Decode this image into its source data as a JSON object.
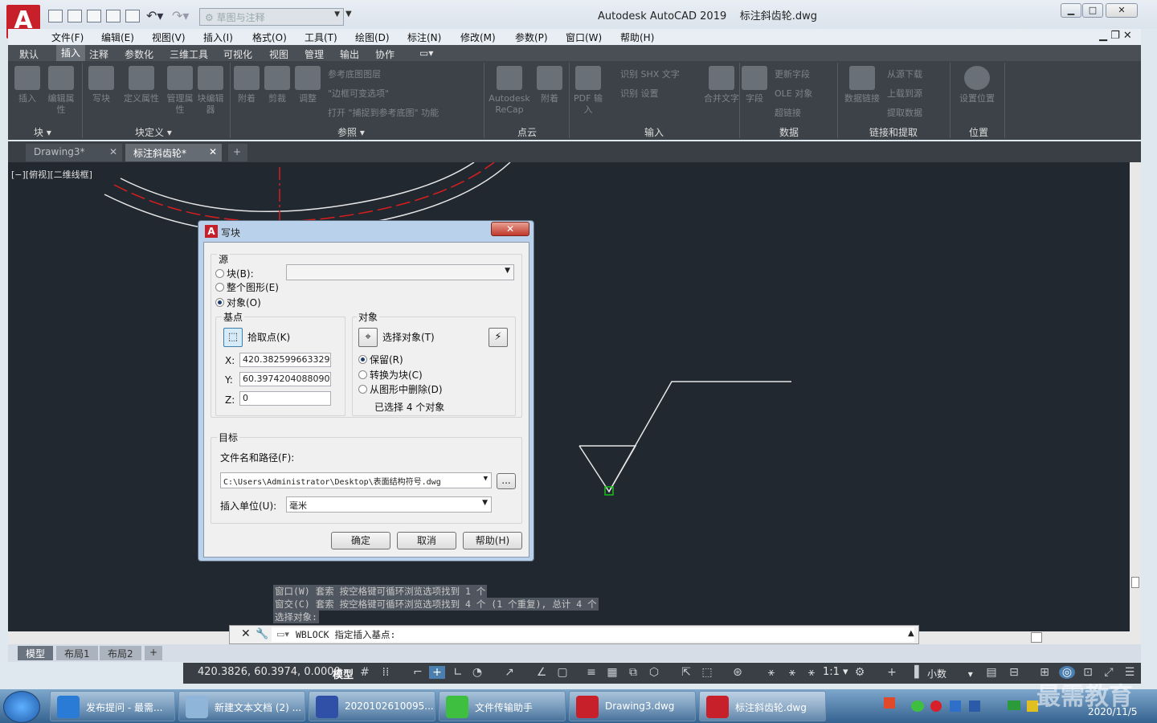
{
  "window": {
    "app_title": "Autodesk AutoCAD 2019",
    "file_title": "标注斜齿轮.dwg",
    "workspace_placeholder": "草图与注释",
    "app_letter": "A"
  },
  "menubar": [
    "文件(F)",
    "编辑(E)",
    "视图(V)",
    "插入(I)",
    "格式(O)",
    "工具(T)",
    "绘图(D)",
    "标注(N)",
    "修改(M)",
    "参数(P)",
    "窗口(W)",
    "帮助(H)"
  ],
  "ribbon_tabs": [
    "默认",
    "插入",
    "注释",
    "参数化",
    "三维工具",
    "可视化",
    "视图",
    "管理",
    "输出",
    "协作"
  ],
  "ribbon_active_tab": "插入",
  "ribbon": {
    "block_buttons": [
      "插入",
      "编辑属性"
    ],
    "blockdef_buttons": [
      "写块",
      "定义属性",
      "管理属性",
      "块编辑器"
    ],
    "ref_buttons": [
      "附着",
      "剪裁",
      "调整"
    ],
    "ref_small": [
      "参考底图图层",
      "\"边框可变选项\"",
      "打开 \"捕捉到参考底图\" 功能"
    ],
    "pointcloud_buttons": [
      "Autodesk ReCap",
      "附着"
    ],
    "import_buttons": [
      "PDF 输入"
    ],
    "import_small": [
      "识别 SHX 文字",
      "识别 设置"
    ],
    "merge_text": "合并文字",
    "field": "字段",
    "data_small": [
      "更新字段",
      "OLE 对象",
      "超链接"
    ],
    "link_buttons": [
      "数据链接"
    ],
    "link_small": [
      "从源下载",
      "上载到源",
      "提取数据"
    ],
    "location_button": "设置位置",
    "panel_labels": [
      "块",
      "块定义",
      "参照",
      "点云",
      "输入",
      "数据",
      "链接和提取",
      "位置"
    ]
  },
  "file_tabs": [
    "Drawing3*",
    "标注斜齿轮*"
  ],
  "active_file_tab": "标注斜齿轮*",
  "viewport_label": "[−][俯视][二维线框]",
  "dialog": {
    "title": "写块",
    "source_label": "源",
    "source_options": [
      "块(B):",
      "整个图形(E)",
      "对象(O)"
    ],
    "source_selected": "对象(O)",
    "basepoint_label": "基点",
    "pick_point": "拾取点(K)",
    "x_label": "X:",
    "x_value": "420.3825996633295",
    "y_label": "Y:",
    "y_value": "60.39742040880901",
    "z_label": "Z:",
    "z_value": "0",
    "objects_label": "对象",
    "select_objects": "选择对象(T)",
    "object_options": [
      "保留(R)",
      "转换为块(C)",
      "从图形中删除(D)"
    ],
    "object_selected": "保留(R)",
    "selected_count": "已选择 4 个对象",
    "target_label": "目标",
    "filename_label": "文件名和路径(F):",
    "filename_value": "C:\\Users\\Administrator\\Desktop\\表面结构符号.dwg",
    "browse_label": "...",
    "units_label": "插入单位(U):",
    "units_value": "毫米",
    "ok": "确定",
    "cancel": "取消",
    "help": "帮助(H)"
  },
  "command_history": [
    "窗口(W) 套索  按空格键可循环浏览选项找到 1 个",
    "窗交(C) 套索  按空格键可循环浏览选项找到 4 个 (1 个重复), 总计 4 个",
    "选择对象:"
  ],
  "command_line": "WBLOCK 指定插入基点:",
  "layout_tabs": [
    "模型",
    "布局1",
    "布局2"
  ],
  "active_layout": "模型",
  "status": {
    "coords": "420.3826, 60.3974, 0.0000",
    "model": "模型",
    "scale": "1:1",
    "units": "小数"
  },
  "taskbar": {
    "items": [
      "发布提问 - 最需...",
      "新建文本文档 (2) ...",
      "2020102610095...",
      "文件传输助手",
      "Drawing3.dwg",
      "标注斜齿轮.dwg"
    ],
    "date": "2020/11/5"
  },
  "watermark": "最需教育",
  "colors": {
    "accent": "#c7202a",
    "canvas": "#212830",
    "ribbon": "#3d4248",
    "selection_green": "#18c018"
  }
}
